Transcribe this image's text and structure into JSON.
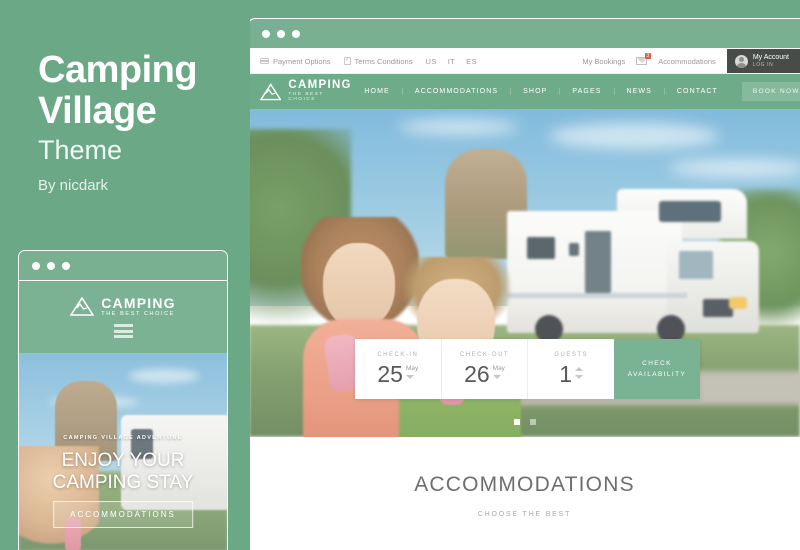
{
  "promo": {
    "title_line1": "Camping",
    "title_line2": "Village",
    "subtitle": "Theme",
    "author": "By nicdark",
    "accent": "#6ba886"
  },
  "mobile": {
    "logo_name": "CAMPING",
    "logo_tagline": "THE BEST CHOICE",
    "hero_kicker": "CAMPING VILLAGE ADVENTURE",
    "hero_title_line1": "ENJOY YOUR",
    "hero_title_line2": "CAMPING STAY",
    "hero_button": "ACCOMMODATIONS"
  },
  "browser": {
    "topbar": {
      "payment_options": "Payment Options",
      "terms_conditions": "Terms Conditions",
      "languages": [
        "US",
        "IT",
        "ES"
      ],
      "my_bookings": "My Bookings",
      "mail_badge": "3",
      "accommodations": "Accommodations",
      "account_name": "My Account",
      "account_sub": "LOG IN"
    },
    "nav": {
      "logo_name": "CAMPING",
      "logo_tagline": "THE BEST CHOICE",
      "links": [
        "HOME",
        "ACCOMMODATIONS",
        "SHOP",
        "PAGES",
        "NEWS",
        "CONTACT"
      ],
      "cta": "BOOK NOW",
      "bar_color": "#6eac89"
    },
    "booking": {
      "checkin_label": "CHECK-IN",
      "checkin_day": "25",
      "checkin_month": "May",
      "checkout_label": "CHECK-OUT",
      "checkout_day": "26",
      "checkout_month": "May",
      "guests_label": "GUESTS",
      "guests_value": "1",
      "cta_line1": "CHECK",
      "cta_line2": "AVAILABILITY",
      "cta_color": "#79b394"
    },
    "section": {
      "title": "ACCOMMODATIONS",
      "subtitle": "CHOOSE THE BEST"
    }
  }
}
